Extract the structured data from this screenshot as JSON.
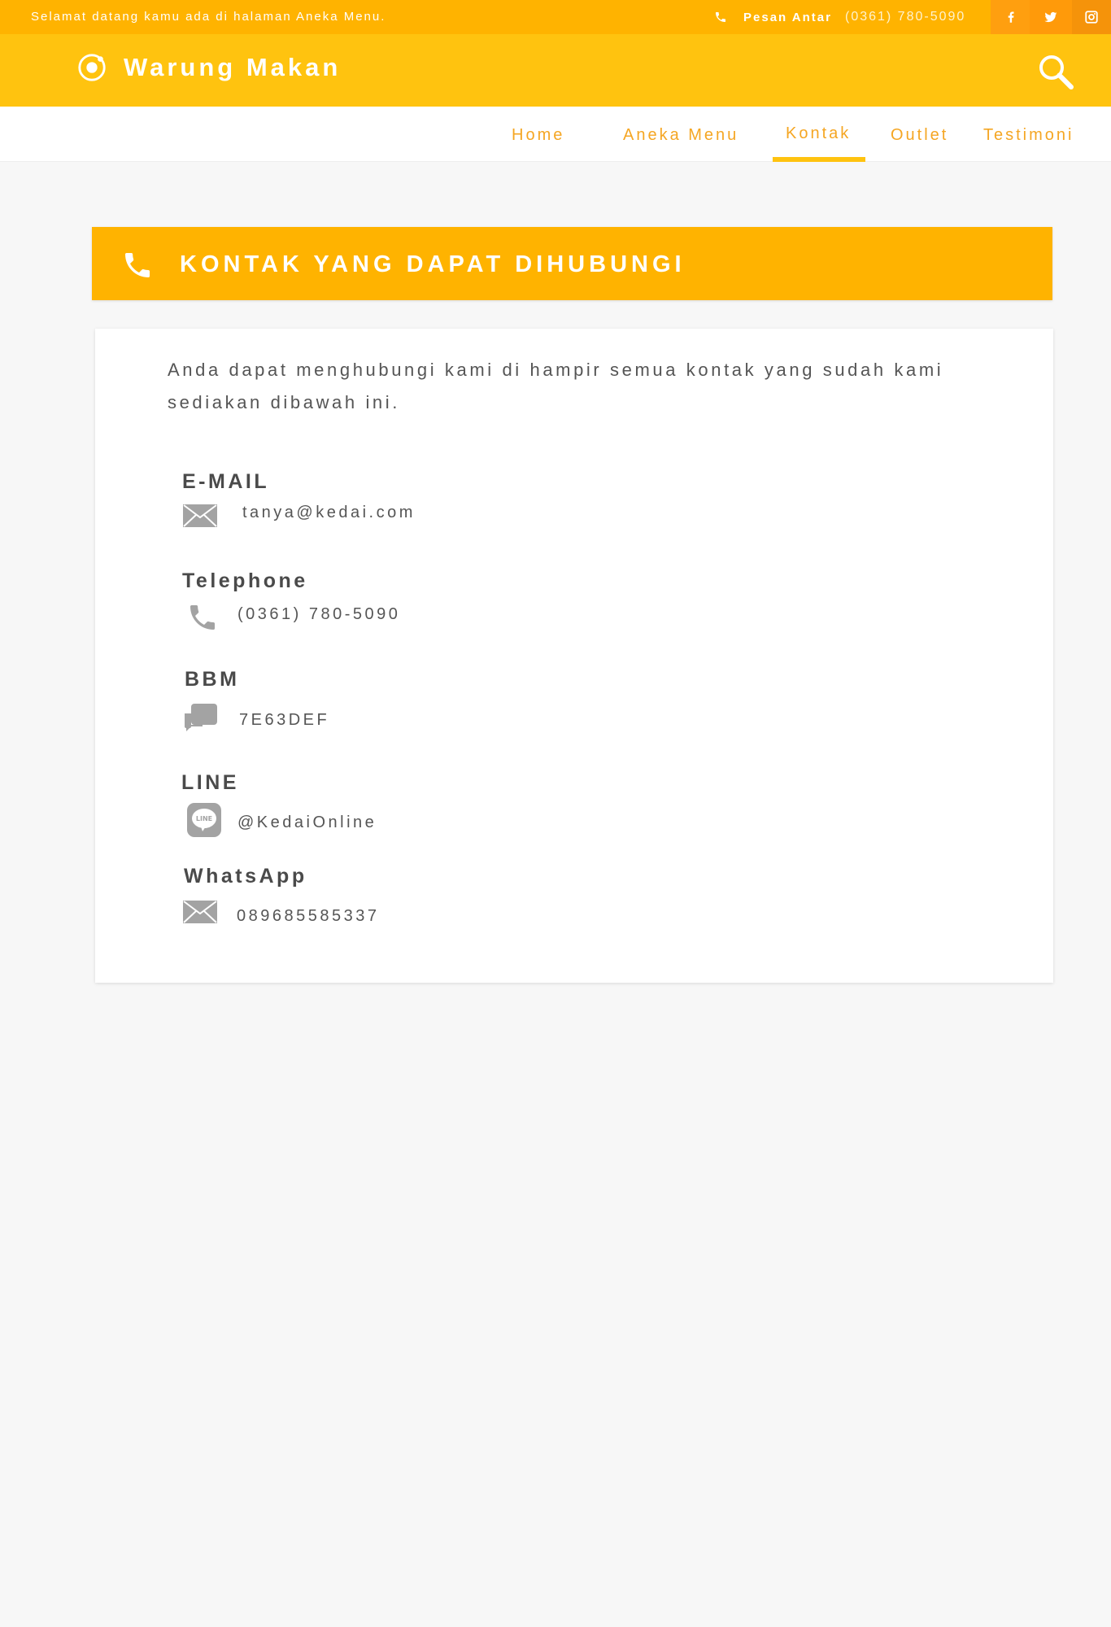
{
  "topbar": {
    "welcome": "Selamat datang kamu ada di halaman Aneka Menu.",
    "order_label": "Pesan Antar",
    "order_phone": "(0361) 780-5090",
    "social": [
      "facebook-icon",
      "twitter-icon",
      "instagram-icon"
    ]
  },
  "header": {
    "brand": "Warung Makan"
  },
  "nav": {
    "items": [
      {
        "label": "Home"
      },
      {
        "label": "Aneka Menu"
      },
      {
        "label": "Kontak"
      },
      {
        "label": "Outlet"
      },
      {
        "label": "Testimoni"
      }
    ],
    "active": "Kontak"
  },
  "section": {
    "title": "KONTAK YANG DAPAT DIHUBUNGI"
  },
  "card": {
    "intro": "Anda dapat menghubungi kami di hampir semua kontak yang sudah kami sediakan dibawah ini.",
    "contacts": [
      {
        "heading": "E-MAIL",
        "value": "tanya@kedai.com",
        "icon": "envelope-icon"
      },
      {
        "heading": "Telephone",
        "value": "(0361) 780-5090",
        "icon": "phone-icon"
      },
      {
        "heading": "BBM",
        "value": "7E63DEF",
        "icon": "chat-icon"
      },
      {
        "heading": "LINE",
        "value": "@KedaiOnline",
        "icon": "line-icon"
      },
      {
        "heading": "WhatsApp",
        "value": "089685585337",
        "icon": "envelope-icon"
      }
    ]
  },
  "colors": {
    "topbar": "#ffb300",
    "header": "#ffc30f",
    "accent": "#f5a623",
    "background": "#f7f7f7"
  }
}
